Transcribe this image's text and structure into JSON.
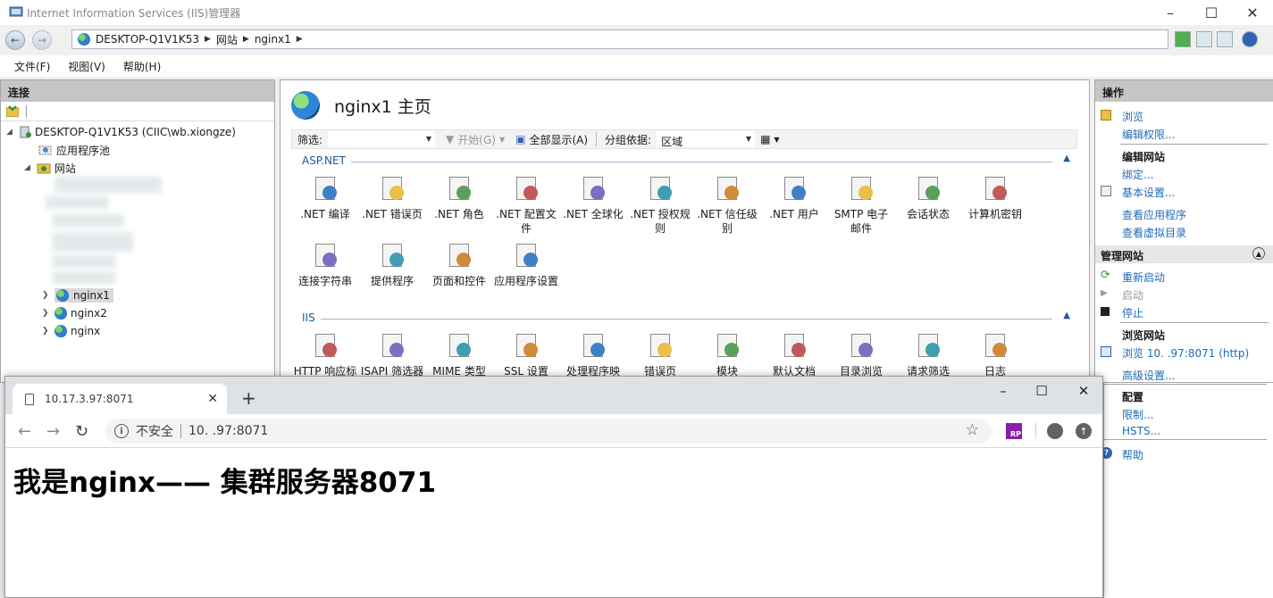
{
  "iis": {
    "title": "Internet Information Services (IIS)管理器",
    "address": {
      "crumbs": [
        "DESKTOP-Q1V1K53",
        "网站",
        "nginx1"
      ]
    },
    "menu": [
      "文件(F)",
      "视图(V)",
      "帮助(H)"
    ],
    "connections": {
      "header": "连接",
      "tree": {
        "server": "DESKTOP-Q1V1K53 (CIIC\\wb.xiongze)",
        "apppools": "应用程序池",
        "sites": "网站",
        "site_items": [
          "nginx1",
          "nginx2",
          "nginx"
        ]
      }
    },
    "main": {
      "title": "nginx1 主页",
      "filter": {
        "label": "筛选:",
        "start": "开始(G)",
        "show_all": "全部显示(A)",
        "group_by_label": "分组依据:",
        "group_by_value": "区域"
      },
      "sections": [
        {
          "name": "ASP.NET",
          "features": [
            ".NET 编译",
            ".NET 错误页",
            ".NET 角色",
            ".NET 配置文件",
            ".NET 全球化",
            ".NET 授权规则",
            ".NET 信任级别",
            ".NET 用户",
            "SMTP 电子邮件",
            "会话状态",
            "计算机密钥",
            "连接字符串",
            "提供程序",
            "页面和控件",
            "应用程序设置"
          ]
        },
        {
          "name": "IIS",
          "features": [
            "HTTP 响应标",
            "ISAPI 筛选器",
            "MIME 类型",
            "SSL 设置",
            "处理程序映",
            "错误页",
            "模块",
            "默认文档",
            "目录浏览",
            "请求筛选",
            "日志"
          ]
        }
      ]
    },
    "actions": {
      "header": "操作",
      "browse": "浏览",
      "edit_perms": "编辑权限...",
      "edit_site": "编辑网站",
      "bindings": "绑定...",
      "basic_settings": "基本设置...",
      "view_apps": "查看应用程序",
      "view_vdirs": "查看虚拟目录",
      "manage_site": "管理网站",
      "restart": "重新启动",
      "start": "启动",
      "stop": "停止",
      "browse_site": "浏览网站",
      "browse_link": "浏览 10.      .97:8071 (http)",
      "advanced": "高级设置...",
      "config": "配置",
      "limits": "限制...",
      "hsts": "HSTS...",
      "help": "帮助"
    }
  },
  "chrome": {
    "tab_title": "10.17.3.97:8071",
    "not_secure": "不安全",
    "url": "10.      .97:8071",
    "page_heading": "我是nginx—— 集群服务器8071"
  },
  "colors": {
    "link": "#1e6bb8",
    "section": "#1c5a9a",
    "panel_header": "#c5c5c5",
    "rp_extension": "#8b1fa9"
  }
}
